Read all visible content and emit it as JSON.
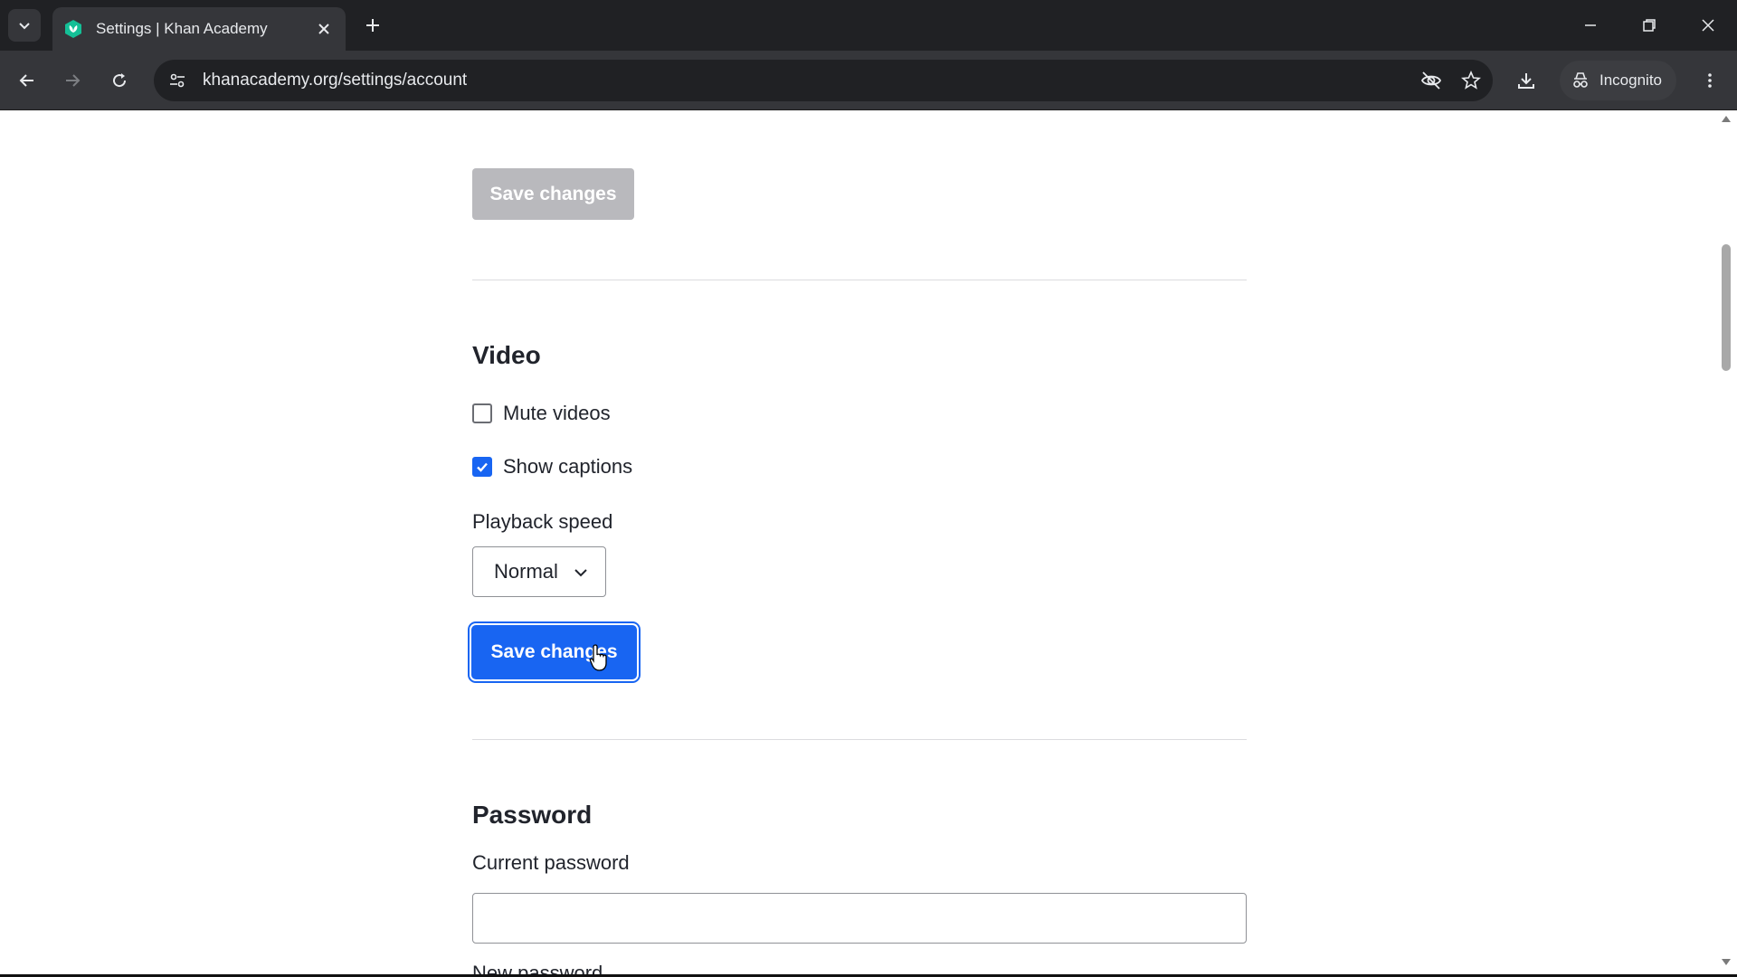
{
  "browser": {
    "tab_title": "Settings | Khan Academy",
    "url": "khanacademy.org/settings/account",
    "incognito_label": "Incognito",
    "icons": {
      "tab_search": "chevron-down-icon",
      "favicon": "khan-academy-leaf-icon",
      "tab_close": "close-icon",
      "new_tab": "plus-icon",
      "back": "arrow-left-icon",
      "forward": "arrow-right-icon",
      "reload": "reload-icon",
      "site_info": "tune-icon",
      "tracking": "eye-off-icon",
      "bookmark": "star-icon",
      "download": "download-icon",
      "incognito": "incognito-icon",
      "menu": "kebab-menu-icon"
    }
  },
  "page": {
    "top_save_label": "Save changes",
    "video": {
      "heading": "Video",
      "mute_label": "Mute videos",
      "mute_checked": false,
      "captions_label": "Show captions",
      "captions_checked": true,
      "playback_label": "Playback speed",
      "playback_value": "Normal",
      "save_label": "Save changes"
    },
    "password": {
      "heading": "Password",
      "current_label": "Current password",
      "current_value": "",
      "new_label": "New password"
    }
  },
  "colors": {
    "primary": "#1865f2",
    "disabled": "#b9b9bd",
    "text": "#21242c"
  }
}
